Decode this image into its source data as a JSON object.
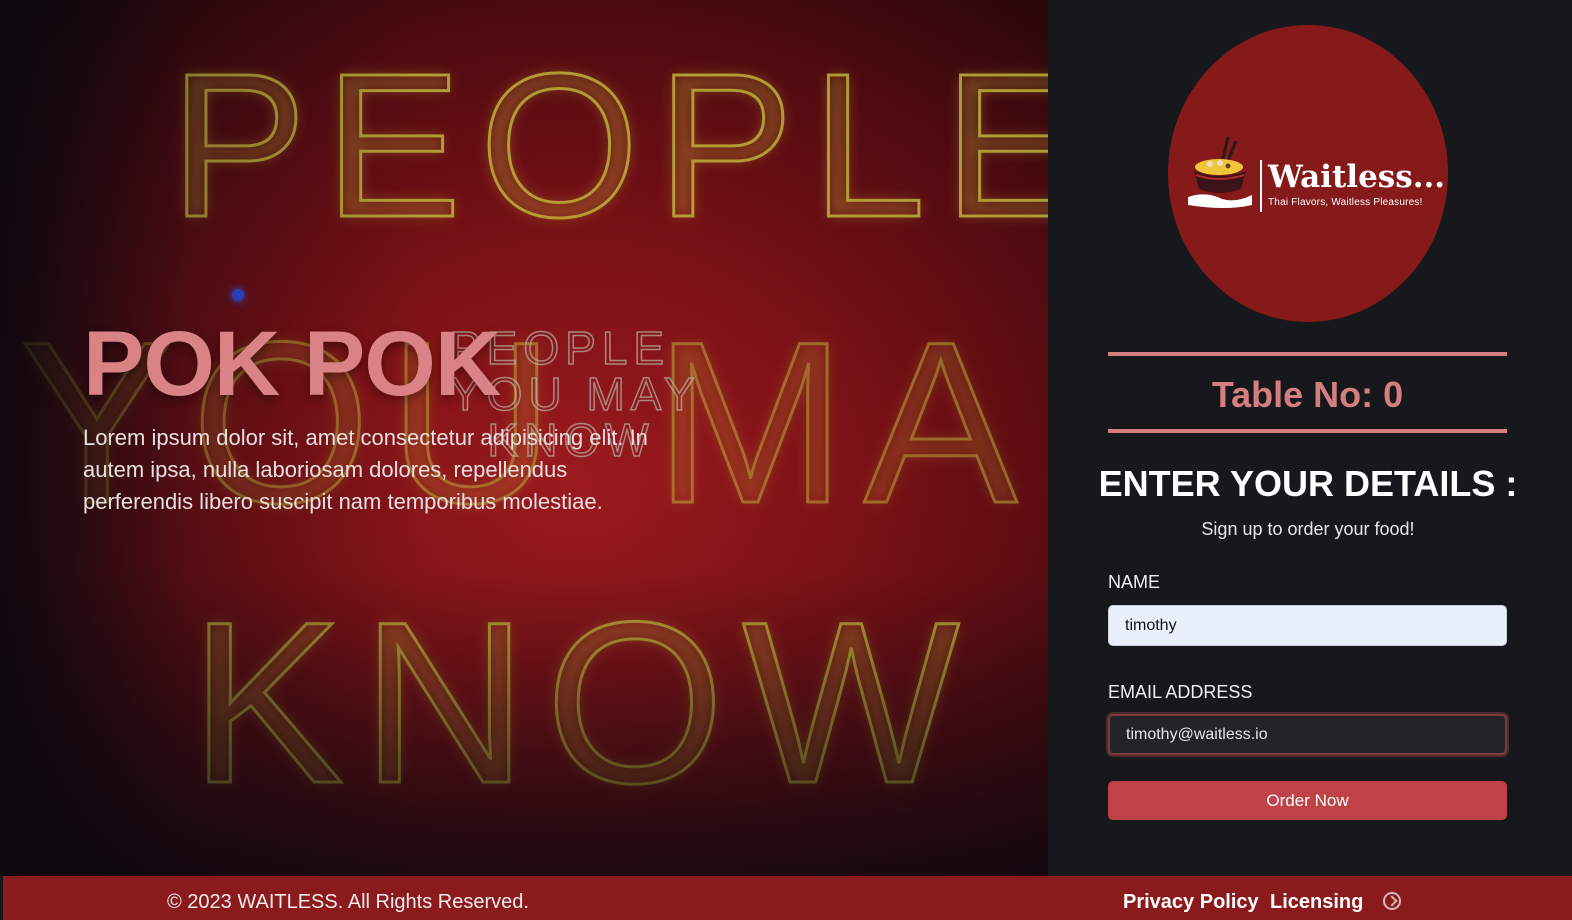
{
  "hero": {
    "title": "POK POK",
    "description": "Lorem ipsum dolor sit, amet consectetur adipisicing elit. In autem ipsa, nulla laboriosam dolores, repellendus perferendis libero suscipit nam temporibus molestiae."
  },
  "logo": {
    "name": "Waitless...",
    "tagline": "Thai Flavors, Waitless Pleasures!"
  },
  "table": {
    "label": "Table No: 0"
  },
  "form": {
    "heading": "ENTER YOUR DETAILS :",
    "subheading": "Sign up to order your food!",
    "name_label": "NAME",
    "name_value": "timothy",
    "email_label": "EMAIL ADDRESS",
    "email_value": "timothy@waitless.io",
    "submit_label": "Order Now"
  },
  "footer": {
    "copyright": "© 2023 WAITLESS. All Rights Reserved.",
    "links": [
      "Privacy Policy",
      "Licensing"
    ],
    "icon": "compass-icon"
  },
  "colors": {
    "accent": "#d57e80",
    "button": "#bf4246",
    "footer": "#8b1a1c",
    "logo_circle": "#861a1a",
    "panel_bg": "#17181b"
  }
}
